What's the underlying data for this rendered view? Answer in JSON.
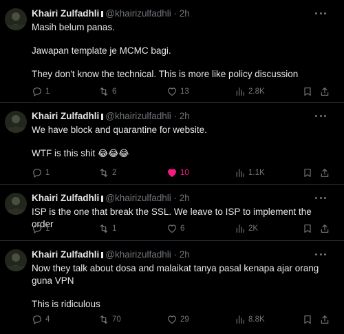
{
  "tweets": [
    {
      "author": "Khairi Zulfadhli",
      "handle": "@khairizulfadhli",
      "sep": "·",
      "time": "2h",
      "paragraphs": [
        "Masih belum panas.",
        "Jawapan template je MCMC bagi.",
        "They don't know the technical. This is more like policy discussion"
      ],
      "replies": "1",
      "reposts": "6",
      "likes": "13",
      "views": "2.8K",
      "liked": false
    },
    {
      "author": "Khairi Zulfadhli",
      "handle": "@khairizulfadhli",
      "sep": "·",
      "time": "2h",
      "paragraphs": [
        "We have block and quarantine for website.",
        "WTF is this shit"
      ],
      "emoji": "😂😂😂",
      "replies": "1",
      "reposts": "2",
      "likes": "10",
      "views": "1.1K",
      "liked": true
    },
    {
      "author": "Khairi Zulfadhli",
      "handle": "@khairizulfadhli",
      "sep": "·",
      "time": "2h",
      "paragraphs": [
        "ISP is the one that break the SSL. We leave to ISP to implement the order"
      ],
      "replies": "1",
      "reposts": "1",
      "likes": "6",
      "views": "2K",
      "liked": false
    },
    {
      "author": "Khairi Zulfadhli",
      "handle": "@khairizulfadhli",
      "sep": "·",
      "time": "2h",
      "paragraphs": [
        "Now they talk about dosa and malaikat tanya pasal kenapa ajar orang guna VPN",
        "This is ridiculous"
      ],
      "replies": "4",
      "reposts": "70",
      "likes": "29",
      "views": "8.8K",
      "liked": false
    }
  ],
  "colors": {
    "background": "#000000",
    "text": "#e7e9ea",
    "muted": "#71767b",
    "like_active": "#f91880",
    "divider": "#2f3336"
  },
  "icons": [
    "reply-icon",
    "repost-icon",
    "like-icon",
    "views-icon",
    "bookmark-icon",
    "share-icon",
    "more-icon",
    "verified-icon"
  ]
}
